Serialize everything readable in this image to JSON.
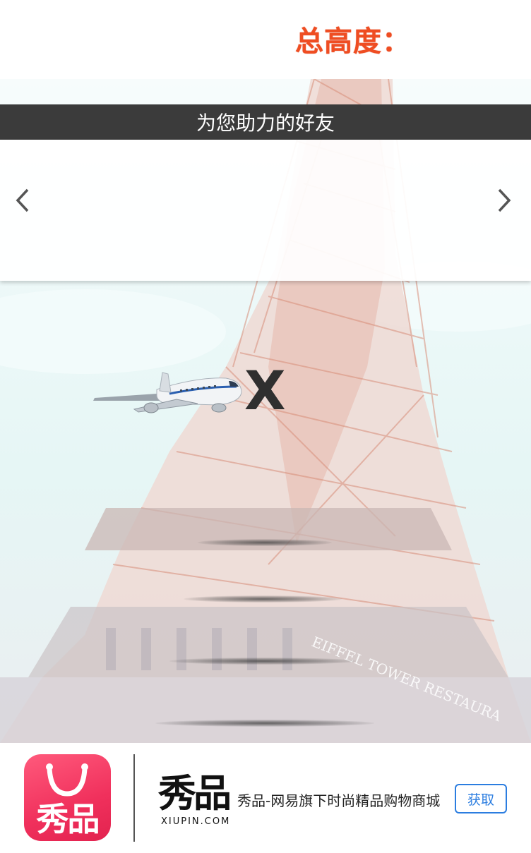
{
  "header": {
    "total_height_label": "总高度："
  },
  "friends": {
    "title": "为您助力的好友"
  },
  "game": {
    "multiplier": "X"
  },
  "ad": {
    "app_icon_text": "秀品",
    "brand_name": "秀品",
    "brand_domain": "XIUPIN.COM",
    "description": "秀品-网易旗下时尚精品购物商城",
    "get_button": "获取"
  },
  "background": {
    "tower_sign": "EIFFEL TOWER RESTAURA"
  },
  "colors": {
    "accent": "#ef4d22",
    "bar": "#3b3b3b",
    "ad_pink": "#f0305c",
    "link_blue": "#2b7de0"
  }
}
